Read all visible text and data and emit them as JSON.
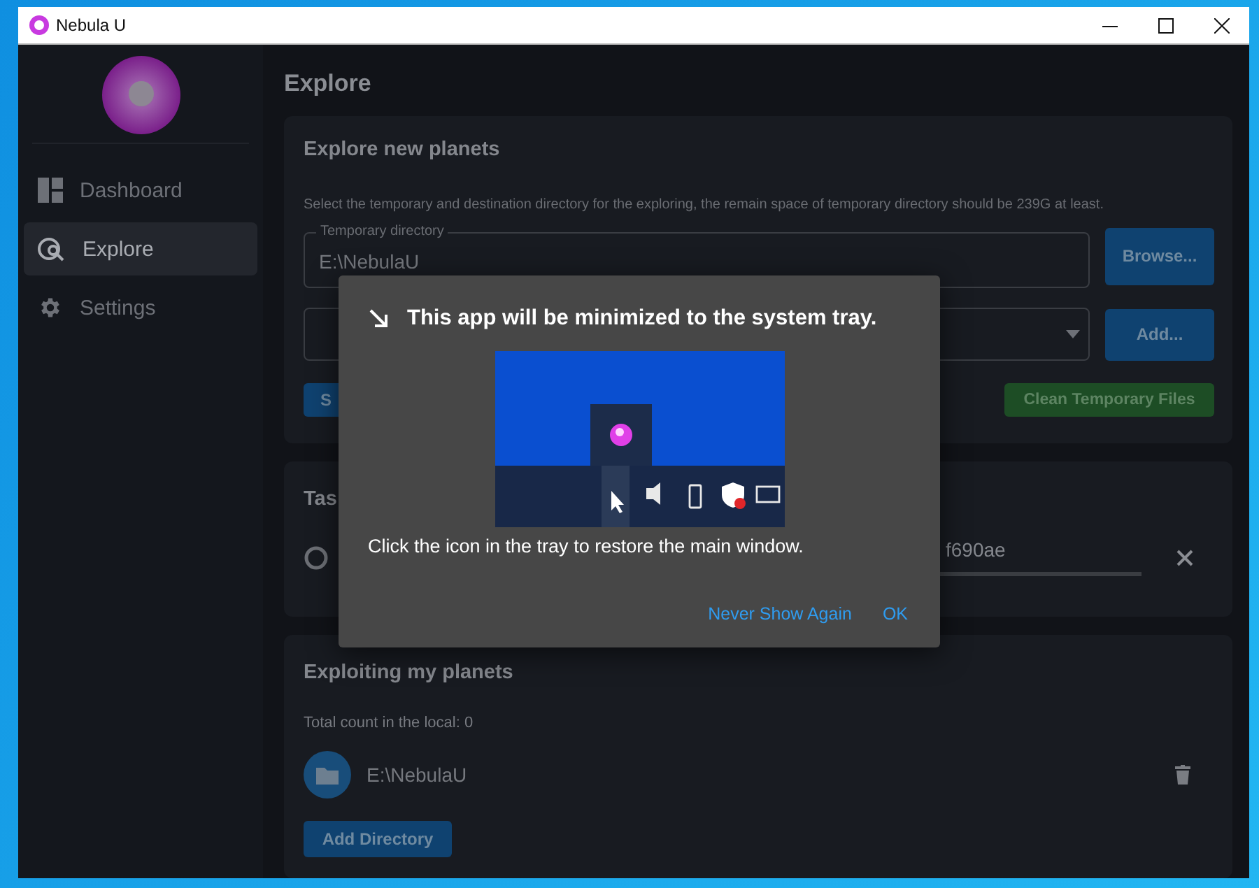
{
  "window": {
    "title": "Nebula U"
  },
  "sidebar": {
    "items": [
      {
        "label": "Dashboard",
        "selected": false
      },
      {
        "label": "Explore",
        "selected": true
      },
      {
        "label": "Settings",
        "selected": false
      }
    ]
  },
  "page_title": "Explore",
  "explore_card": {
    "title": "Explore new planets",
    "description": "Select the temporary and destination directory for the exploring, the remain space of temporary directory should be 239G at least.",
    "temp_field": {
      "label": "Temporary directory",
      "value": "E:\\NebulaU"
    },
    "browse_button": "Browse...",
    "add_button": "Add...",
    "start_button": "S",
    "clean_button": "Clean Temporary Files"
  },
  "tasks_card": {
    "title": "Tas",
    "task": {
      "name": "f690ae",
      "level": 0
    }
  },
  "planets_card": {
    "title": "Exploiting my planets",
    "count": "Total count in the local: 0",
    "directories": [
      {
        "path": "E:\\NebulaU"
      }
    ],
    "add_button": "Add Directory"
  },
  "dialog": {
    "title": "This app will be minimized to the system tray.",
    "picture": {
      "kind": "picture"
    },
    "message": "Click the icon in the tray to restore the main window.",
    "buttons": [
      "Never Show Again",
      "OK"
    ]
  }
}
